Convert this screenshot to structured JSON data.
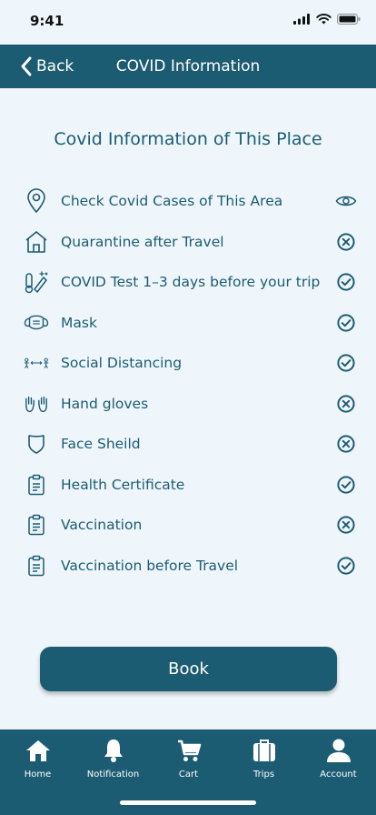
{
  "status_bar": {
    "time": "9:41"
  },
  "nav": {
    "back_label": "Back",
    "title": "COVID Information"
  },
  "heading": "Covid Information of This Place",
  "items": [
    {
      "icon": "location-pin-icon",
      "label": "Check Covid Cases of This Area",
      "status": "view"
    },
    {
      "icon": "house-icon",
      "label": "Quarantine after Travel",
      "status": "not-required"
    },
    {
      "icon": "test-kit-icon",
      "label": "COVID Test 1–3 days before your trip",
      "status": "required"
    },
    {
      "icon": "mask-icon",
      "label": "Mask",
      "status": "required"
    },
    {
      "icon": "social-distancing-icon",
      "label": "Social Distancing",
      "status": "required"
    },
    {
      "icon": "hand-gloves-icon",
      "label": "Hand gloves",
      "status": "not-required"
    },
    {
      "icon": "shield-icon",
      "label": "Face Sheild",
      "status": "not-required"
    },
    {
      "icon": "clipboard-icon",
      "label": "Health Certificate",
      "status": "required"
    },
    {
      "icon": "clipboard-icon",
      "label": "Vaccination",
      "status": "not-required"
    },
    {
      "icon": "clipboard-icon",
      "label": "Vaccination before Travel",
      "status": "required"
    }
  ],
  "book_button": {
    "label": "Book"
  },
  "tabs": [
    {
      "icon": "home-icon",
      "label": "Home"
    },
    {
      "icon": "bell-icon",
      "label": "Notification"
    },
    {
      "icon": "cart-icon",
      "label": "Cart"
    },
    {
      "icon": "suitcase-icon",
      "label": "Trips"
    },
    {
      "icon": "user-icon",
      "label": "Account"
    }
  ],
  "colors": {
    "primary": "#1c5c72",
    "background": "#eef6fb",
    "on_primary": "#ffffff"
  }
}
